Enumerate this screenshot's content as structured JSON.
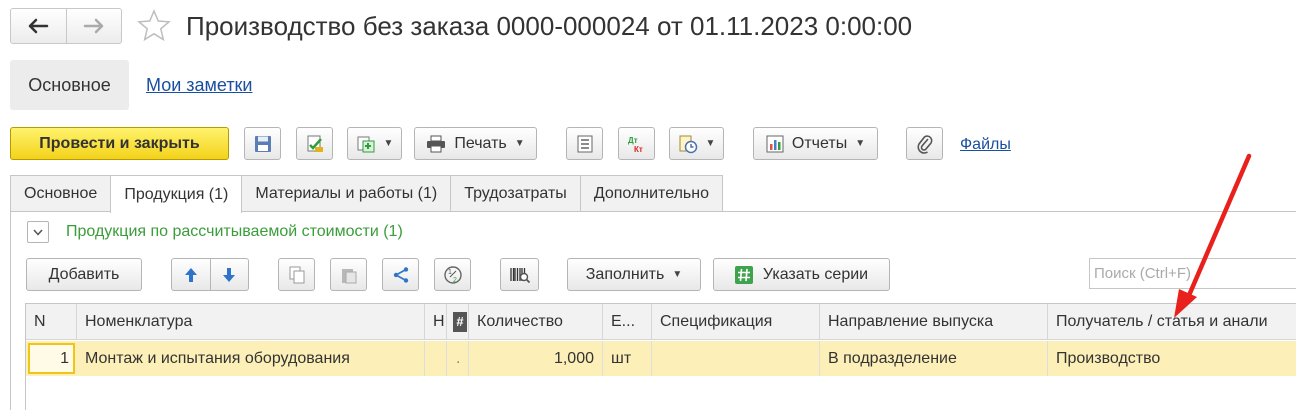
{
  "header": {
    "back_icon": "arrow-left-icon",
    "forward_icon": "arrow-right-icon",
    "favorite_icon": "star-icon",
    "title": "Производство без заказа 0000-000024 от 01.11.2023 0:00:00"
  },
  "panel": {
    "main_tab": "Основное",
    "notes_link": "Мои заметки"
  },
  "toolbar": {
    "post_close": "Провести и закрыть",
    "print": "Печать",
    "reports": "Отчеты",
    "files": "Файлы"
  },
  "tabs": [
    {
      "label": "Основное"
    },
    {
      "label": "Продукция (1)"
    },
    {
      "label": "Материалы и работы (1)"
    },
    {
      "label": "Трудозатраты"
    },
    {
      "label": "Дополнительно"
    }
  ],
  "group": {
    "title": "Продукция по рассчитываемой стоимости (1)"
  },
  "table_toolbar": {
    "add": "Добавить",
    "fill": "Заполнить",
    "series": "Указать серии",
    "search_placeholder": "Поиск (Ctrl+F)"
  },
  "table": {
    "columns": [
      "N",
      "Номенклатура",
      "Н",
      "#",
      "Количество",
      "Е...",
      "Спецификация",
      "Направление выпуска",
      "Получатель / статья и анали"
    ],
    "rows": [
      {
        "n": "1",
        "nomenclature": "Монтаж и испытания оборудования",
        "h": "",
        "mark": ".",
        "quantity": "1,000",
        "unit": "шт",
        "spec": "",
        "direction": "В подразделение",
        "recipient": "Производство"
      }
    ]
  },
  "colors": {
    "primary_button": "#f3d21a",
    "link": "#1a4fa0",
    "group_title": "#3a9d3a",
    "selected_row": "#fcf0b8",
    "annotation_arrow": "#e8211c"
  }
}
